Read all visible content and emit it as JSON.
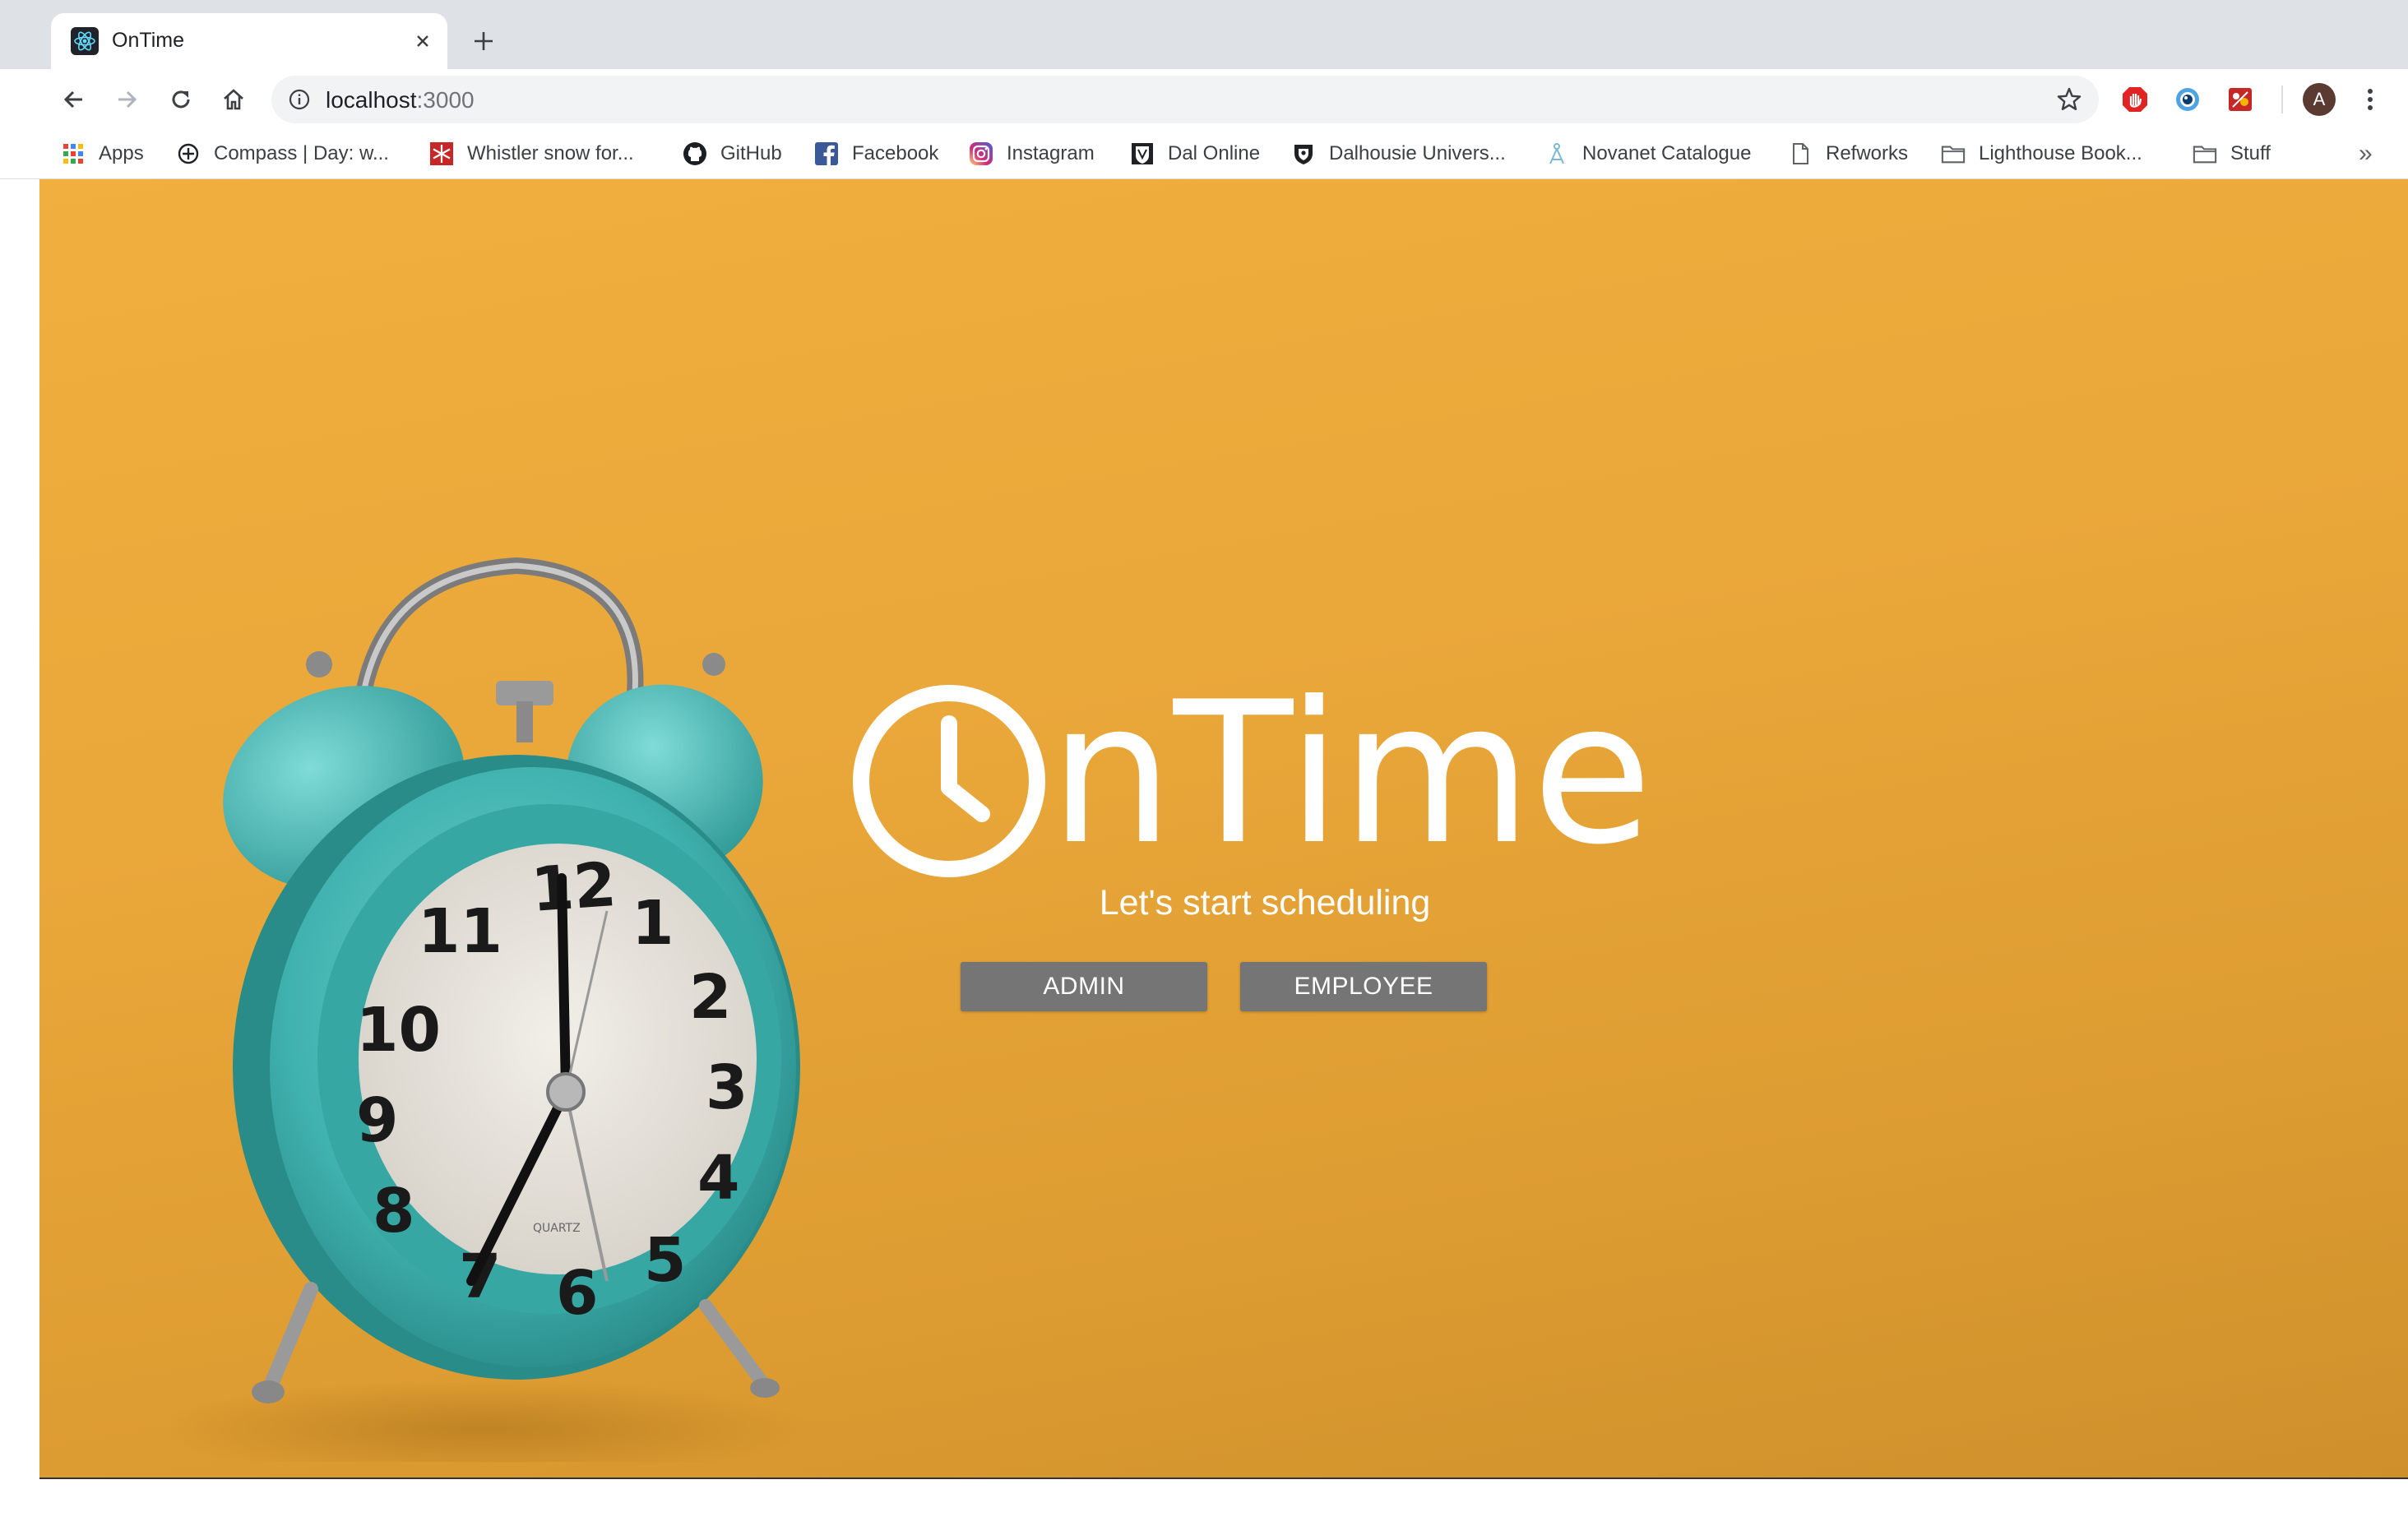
{
  "browser": {
    "tab": {
      "title": "OnTime",
      "favicon": "react-icon"
    },
    "url": {
      "host": "localhost",
      "port": ":3000"
    },
    "bookmarks": [
      {
        "label": "Apps",
        "icon": "apps-grid-icon"
      },
      {
        "label": "Compass | Day: w...",
        "icon": "compass-icon"
      },
      {
        "label": "Whistler snow for...",
        "icon": "snowflake-icon"
      },
      {
        "label": "GitHub",
        "icon": "github-icon"
      },
      {
        "label": "Facebook",
        "icon": "facebook-icon"
      },
      {
        "label": "Instagram",
        "icon": "instagram-icon"
      },
      {
        "label": "Dal Online",
        "icon": "dal-shield-icon"
      },
      {
        "label": "Dalhousie Univers...",
        "icon": "shield-icon"
      },
      {
        "label": "Novanet Catalogue",
        "icon": "novanet-icon"
      },
      {
        "label": "Refworks",
        "icon": "page-icon"
      },
      {
        "label": "Lighthouse Book...",
        "icon": "folder-icon"
      },
      {
        "label": "Stuff",
        "icon": "folder-icon"
      }
    ],
    "more_bookmarks": "»",
    "avatar_initial": "A"
  },
  "page": {
    "logo_text": "nTime",
    "tagline": "Let's start scheduling",
    "buttons": {
      "admin": "ADMIN",
      "employee": "EMPLOYEE"
    }
  },
  "colors": {
    "background": "#eaa73a",
    "clock_teal": "#4fbfbc",
    "button": "#757575"
  }
}
